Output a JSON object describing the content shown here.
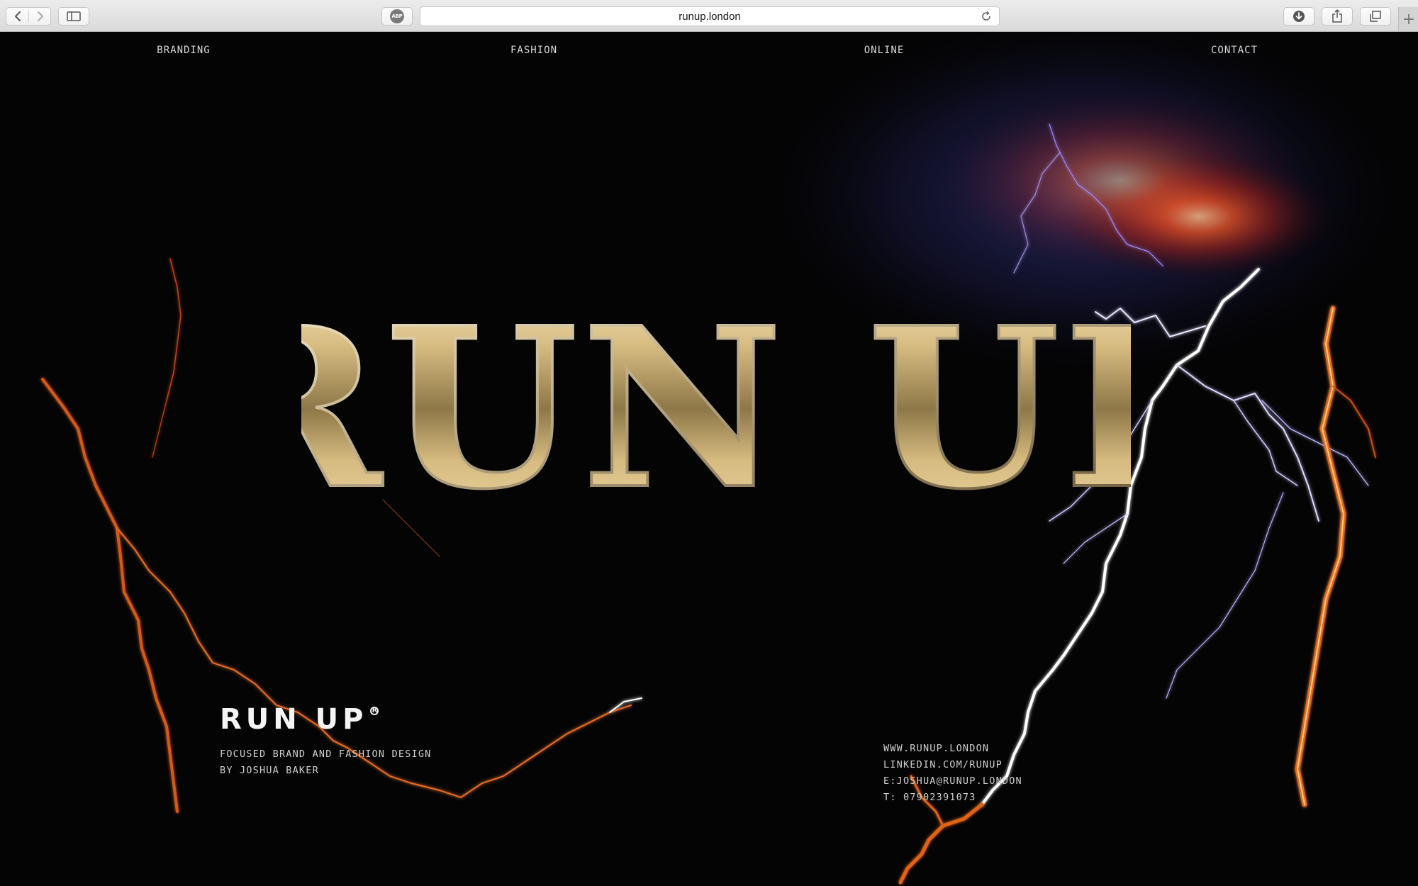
{
  "browser": {
    "url": "runup.london",
    "adblock_label": "ABP"
  },
  "nav": {
    "items": [
      {
        "label": "BRANDING"
      },
      {
        "label": "FASHION"
      },
      {
        "label": "ONLINE"
      },
      {
        "label": "CONTACT"
      }
    ]
  },
  "hero": {
    "title": "RUN UP"
  },
  "brand": {
    "logo": "RUN UP",
    "logo_mark": "R",
    "tagline_line1": "FOCUSED BRAND AND FASHION DESIGN",
    "tagline_line2": "BY JOSHUA BAKER"
  },
  "contact": {
    "website": "WWW.RUNUP.LONDON",
    "linkedin": "LINKEDIN.COM/RUNUP",
    "email": "E:JOSHUA@RUNUP.LONDON",
    "phone": "T: 07902391073"
  },
  "colors": {
    "background": "#040404",
    "gold_light": "#f3dfae",
    "gold_dark": "#6b5a37",
    "lightning_white": "#ffffff",
    "lightning_orange": "#e0611b",
    "glow_red": "#c0331c",
    "glow_blue": "#2c2f7a"
  }
}
